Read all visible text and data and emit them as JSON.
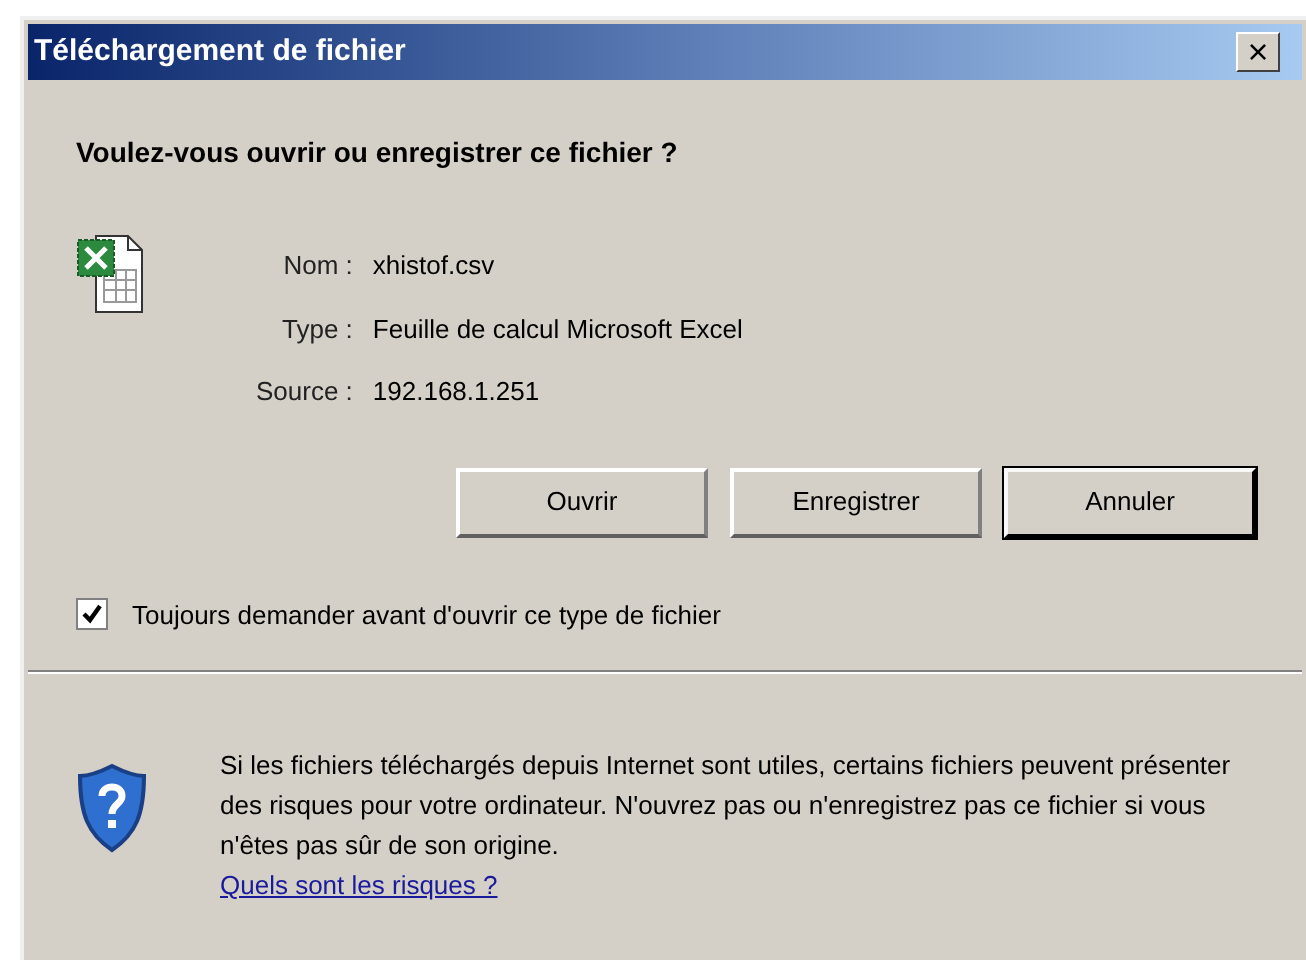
{
  "window": {
    "title": "Téléchargement de fichier",
    "close": "×"
  },
  "question": "Voulez-vous ouvrir ou enregistrer ce fichier ?",
  "details": [
    {
      "label": "Nom :",
      "value": "xhistof.csv"
    },
    {
      "label": "Type :",
      "value": "Feuille de calcul Microsoft Excel"
    },
    {
      "label": "Source :",
      "value": "192.168.1.251"
    }
  ],
  "buttons": [
    {
      "label": "Ouvrir",
      "default": false
    },
    {
      "label": "Enregistrer",
      "default": false
    },
    {
      "label": "Annuler",
      "default": true
    }
  ],
  "always_ask": {
    "label": "Toujours demander avant d'ouvrir ce type de fichier",
    "checked": true
  },
  "warning": {
    "text": "Si les fichiers téléchargés depuis Internet sont utiles, certains fichiers peuvent présenter des risques pour votre ordinateur. N'ouvrez pas ou n'enregistrez pas ce fichier si vous n'êtes pas sûr de son origine.",
    "link": "Quels sont les risques ?"
  }
}
